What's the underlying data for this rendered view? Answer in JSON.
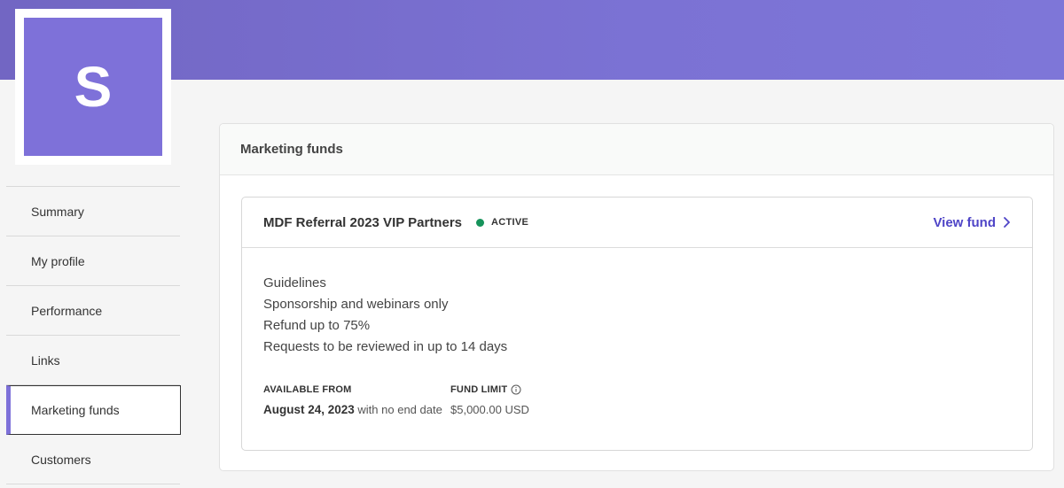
{
  "avatar": {
    "letter": "S"
  },
  "sidebar": {
    "items": [
      {
        "label": "Summary"
      },
      {
        "label": "My profile"
      },
      {
        "label": "Performance"
      },
      {
        "label": "Links"
      },
      {
        "label": "Marketing funds"
      },
      {
        "label": "Customers"
      }
    ],
    "active": "Marketing funds"
  },
  "panel": {
    "title": "Marketing funds",
    "fund": {
      "name": "MDF Referral 2023 VIP Partners",
      "status": "ACTIVE",
      "view_link": "View fund",
      "guidelines": [
        "Guidelines",
        "Sponsorship and webinars only",
        "Refund up to 75%",
        "Requests to be reviewed in up to 14 days"
      ],
      "available_from": {
        "label": "AVAILABLE FROM",
        "date": "August 24, 2023",
        "suffix": " with no end date"
      },
      "fund_limit": {
        "label": "FUND LIMIT",
        "value": "$5,000.00 USD"
      }
    }
  },
  "colors": {
    "brand": "#7e71d9",
    "link": "#4f45c7",
    "status_active": "#16935b"
  },
  "icons": {
    "view_fund": "chevron-right-icon",
    "fund_limit": "info-icon"
  }
}
